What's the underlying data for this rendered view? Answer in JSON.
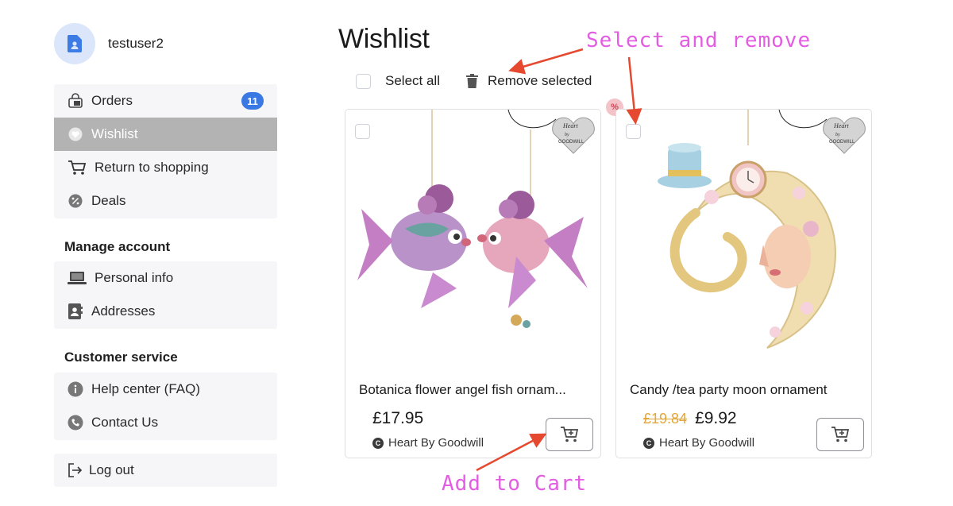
{
  "user": {
    "name": "testuser2",
    "avatar_icon": "user-document-icon"
  },
  "sidebar": {
    "main_items": [
      {
        "label": "Orders",
        "icon": "bag-icon",
        "badge": "11"
      },
      {
        "label": "Wishlist",
        "icon": "heart-icon",
        "active": true
      },
      {
        "label": "Return to shopping",
        "icon": "cart-icon"
      },
      {
        "label": "Deals",
        "icon": "discount-icon"
      }
    ],
    "manage_account": {
      "heading": "Manage account",
      "items": [
        {
          "label": "Personal info",
          "icon": "laptop-icon"
        },
        {
          "label": "Addresses",
          "icon": "contact-card-icon"
        }
      ]
    },
    "customer_service": {
      "heading": "Customer service",
      "items": [
        {
          "label": "Help center (FAQ)",
          "icon": "info-icon"
        },
        {
          "label": "Contact Us",
          "icon": "phone-icon"
        }
      ]
    },
    "logout": {
      "label": "Log out",
      "icon": "logout-icon"
    }
  },
  "main": {
    "title": "Wishlist",
    "toolbar": {
      "select_all": "Select all",
      "remove_selected": "Remove selected"
    },
    "discount_badge": "%",
    "products": [
      {
        "name": "Botanica flower angel fish ornam...",
        "price": "£17.95",
        "old_price": "",
        "brand": "Heart By Goodwill",
        "brand_icon": "C",
        "tag_text": [
          "Heart",
          "by",
          "GOODWILL"
        ]
      },
      {
        "name": "Candy /tea party moon ornament",
        "price": "£9.92",
        "old_price": "£19.84",
        "brand": "Heart By Goodwill",
        "brand_icon": "C",
        "tag_text": [
          "Heart",
          "by",
          "GOODWILL"
        ]
      }
    ]
  },
  "annotations": {
    "select_remove": "Select and remove",
    "add_to_cart": "Add to Cart",
    "color": "#e25de2",
    "arrow_color": "#e5492f"
  }
}
